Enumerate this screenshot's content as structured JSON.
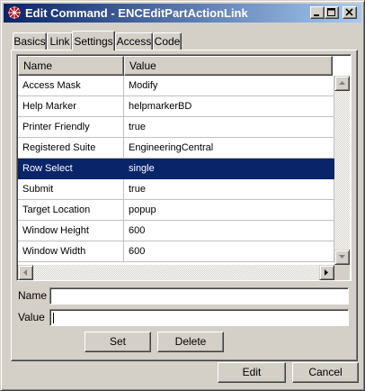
{
  "window": {
    "title": "Edit Command - ENCEditPartActionLink"
  },
  "tabs": [
    {
      "label": "Basics",
      "active": false
    },
    {
      "label": "Link",
      "active": false
    },
    {
      "label": "Settings",
      "active": true
    },
    {
      "label": "Access",
      "active": false
    },
    {
      "label": "Code",
      "active": false
    }
  ],
  "grid": {
    "headers": {
      "name": "Name",
      "value": "Value"
    },
    "rows": [
      {
        "name": "Access Mask",
        "value": "Modify"
      },
      {
        "name": "Help Marker",
        "value": "helpmarkerBD"
      },
      {
        "name": "Printer Friendly",
        "value": "true"
      },
      {
        "name": "Registered Suite",
        "value": "EngineeringCentral"
      },
      {
        "name": "Row Select",
        "value": "single",
        "selected": true
      },
      {
        "name": "Submit",
        "value": "true"
      },
      {
        "name": "Target Location",
        "value": "popup"
      },
      {
        "name": "Window Height",
        "value": "600"
      },
      {
        "name": "Window Width",
        "value": "600"
      }
    ]
  },
  "form": {
    "name_label": "Name",
    "name_value": "",
    "value_label": "Value",
    "value_value": "",
    "set_label": "Set",
    "delete_label": "Delete"
  },
  "footer": {
    "edit_label": "Edit",
    "cancel_label": "Cancel"
  },
  "colors": {
    "title_gradient_start": "#0a246a",
    "title_gradient_end": "#a6caf0",
    "selection": "#0a246a",
    "face": "#d4d0c8"
  },
  "icons": [
    "app-icon",
    "minimize-icon",
    "maximize-icon",
    "close-icon",
    "scroll-up-icon",
    "scroll-down-icon",
    "scroll-left-icon",
    "scroll-right-icon"
  ]
}
